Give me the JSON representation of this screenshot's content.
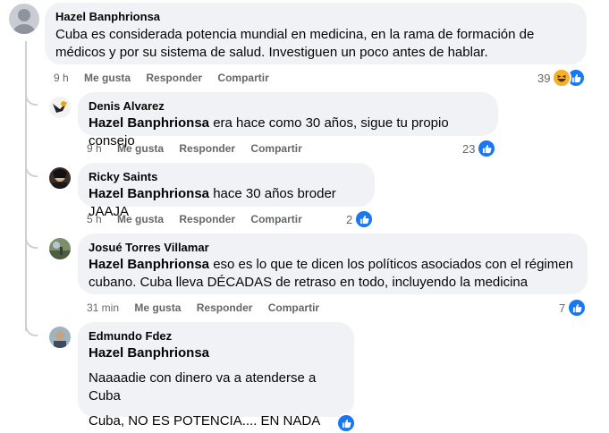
{
  "root_comment": {
    "author": "Hazel Banphrionsa",
    "text": "Cuba es considerada potencia mundial en medicina, en la rama de formación de médicos y por su sistema de salud. Investiguen un poco antes de hablar.",
    "time": "9 h",
    "like_label": "Me gusta",
    "reply_label": "Responder",
    "share_label": "Compartir",
    "reaction_count": "39",
    "reaction_icons": [
      "haha-icon",
      "like-icon"
    ]
  },
  "replies": [
    {
      "author": "Denis Alvarez",
      "mention": "Hazel Banphrionsa",
      "text": " era hace como 30 años, sigue tu propio consejo",
      "time": "9 h",
      "like_label": "Me gusta",
      "reply_label": "Responder",
      "share_label": "Compartir",
      "reaction_count": "23"
    },
    {
      "author": "Ricky Saints",
      "mention": "Hazel Banphrionsa",
      "text": " hace 30 años broder JAAJA",
      "time": "5 h",
      "like_label": "Me gusta",
      "reply_label": "Responder",
      "share_label": "Compartir",
      "reaction_count": "2"
    },
    {
      "author": "Josué Torres Villamar",
      "mention": "Hazel Banphrionsa",
      "text": " eso es lo que te dicen los políticos asociados con el régimen cubano. Cuba lleva DÉCADAS de retraso en todo, incluyendo la medicina",
      "time": "31 min",
      "like_label": "Me gusta",
      "reply_label": "Responder",
      "share_label": "Compartir",
      "reaction_count": "7"
    },
    {
      "author": "Edmundo Fdez",
      "mention": "Hazel Banphrionsa",
      "paragraph1": "Naaaadie con dinero va a atenderse a Cuba",
      "paragraph2": "Cuba, NO ES POTENCIA.... EN NADA"
    }
  ],
  "colors": {
    "bubble": "#f0f2f5",
    "like_blue": "#1877f2",
    "meta_gray": "#65676b"
  }
}
